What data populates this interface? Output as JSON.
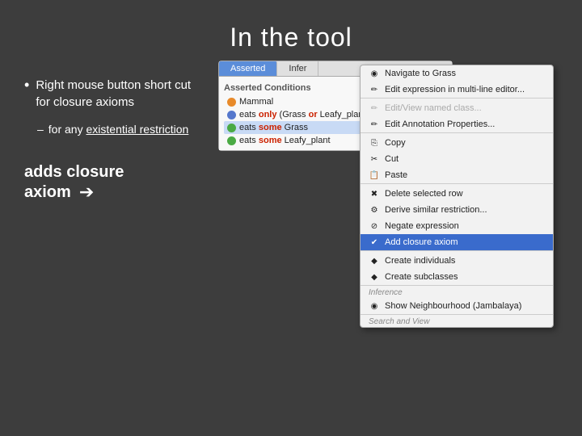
{
  "slide": {
    "title": "In the tool",
    "bullets": [
      {
        "id": "bullet1",
        "text": "Right mouse button short cut for closure axioms"
      }
    ],
    "sub_bullets": [
      {
        "id": "sub1",
        "dash": "–",
        "text": "for any existential restriction",
        "underline": "existential restriction"
      }
    ],
    "adds_closure": {
      "line1": "adds closure",
      "line2": "axiom"
    }
  },
  "protege": {
    "tabs": [
      {
        "label": "Asserted",
        "active": true
      },
      {
        "label": "Infer",
        "active": false
      }
    ],
    "section_header": "Asserted Conditions",
    "axioms": [
      {
        "icon_color": "orange",
        "text": "Mammal"
      },
      {
        "icon_color": "blue",
        "text": "eats only (Grass or Leafy_plant)",
        "keywords": [
          "only",
          "or"
        ],
        "highlighted": false
      },
      {
        "icon_color": "green",
        "text": "eats some Grass",
        "highlighted": true
      },
      {
        "icon_color": "green",
        "text": "eats some Leafy_plant",
        "highlighted": false
      }
    ]
  },
  "context_menu": {
    "items": [
      {
        "id": "navigate",
        "label": "Navigate to Grass",
        "icon": "◉",
        "disabled": false,
        "separator": false
      },
      {
        "id": "edit-multi",
        "label": "Edit expression in multi-line editor...",
        "icon": "✏",
        "disabled": false,
        "separator": false
      },
      {
        "id": "edit-named",
        "label": "Edit/View named class...",
        "icon": "✏",
        "disabled": true,
        "separator": false
      },
      {
        "id": "edit-annotation",
        "label": "Edit Annotation Properties...",
        "icon": "✏",
        "disabled": false,
        "separator": true
      },
      {
        "id": "copy",
        "label": "Copy",
        "icon": "⎘",
        "disabled": false,
        "separator": false
      },
      {
        "id": "cut",
        "label": "Cut",
        "icon": "✂",
        "disabled": false,
        "separator": false
      },
      {
        "id": "paste",
        "label": "Paste",
        "icon": "📋",
        "disabled": false,
        "separator": true
      },
      {
        "id": "delete",
        "label": "Delete selected row",
        "icon": "🗑",
        "disabled": false,
        "separator": false
      },
      {
        "id": "derive",
        "label": "Derive similar restriction...",
        "icon": "⚙",
        "disabled": false,
        "separator": false
      },
      {
        "id": "negate",
        "label": "Negate expression",
        "icon": "⊘",
        "disabled": false,
        "separator": false
      },
      {
        "id": "add-closure",
        "label": "Add closure axiom",
        "icon": "✔",
        "disabled": false,
        "separator": false,
        "highlighted": true
      },
      {
        "id": "create-individuals",
        "label": "Create individuals",
        "icon": "◆",
        "disabled": false,
        "separator": false
      },
      {
        "id": "create-subclasses",
        "label": "Create subclasses",
        "icon": "◆",
        "disabled": false,
        "separator": true
      },
      {
        "id": "inference-label",
        "label": "Inference",
        "is_label": true
      },
      {
        "id": "show-neighbourhood",
        "label": "Show Neighbourhood (Jambalaya)",
        "icon": "◉",
        "disabled": false,
        "separator": true
      },
      {
        "id": "search-view-label",
        "label": "Search and View",
        "is_label": true
      }
    ]
  }
}
